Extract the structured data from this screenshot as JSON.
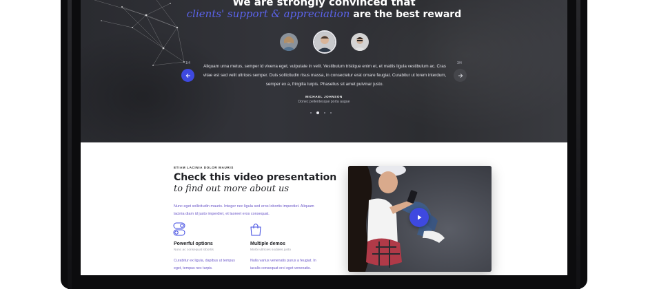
{
  "testimonials": {
    "heading_line1": "We are strongly convinced that",
    "heading_accent": "clients' support & appreciation",
    "heading_rest": " are the best reward",
    "counter_prev": "1/4",
    "counter_next": "3/4",
    "quote": "Aliquam urna metus, semper id viverra eget, vulputate in velit. Vestibulum tristique enim et, et mattis ligula vestibulum ac. Cras vitae est sed velit ultrices semper. Duis sollicitudin risus massa, in consectetur erat ornare feugiat. Curabitur ut lorem interdum, semper ex a, fringilla turpis. Phasellus sit amet pulvinar justo.",
    "author": "MICHAEL JOHNSON",
    "author_role": "Donec pellentesque porta augue",
    "active_slide": 2,
    "slide_count": 4
  },
  "video_section": {
    "eyebrow": "ETIAM LACINIA DOLOR MAURIS",
    "title_line1": "Check this video presentation",
    "title_line2": "to find out more about us",
    "intro": "Nunc eget sollicitudin mauris. Integer nec ligula sed eros lobortis imperdiet. Aliquam lacinia diam id justo imperdiet, et laoreet eros consequat.",
    "features": [
      {
        "icon": "toggle-switch-icon",
        "title": "Powerful options",
        "subtitle": "Nunc ac consequat lobortis",
        "text": "Curabitur ex ligula, dapibus ut tempus eget, tempus nec turpis."
      },
      {
        "icon": "shopping-bag-icon",
        "title": "Multiple demos",
        "subtitle": "Morbi ultricies sodales justo",
        "text": "Nulla varius venenatis purus a feugiat. In iaculis consequat orci eget venenatis."
      }
    ]
  },
  "colors": {
    "accent": "#3e49e0",
    "accent_text": "#5b63ea",
    "dark_bg": "#2e2f34",
    "body_text": "#6a56c8"
  }
}
